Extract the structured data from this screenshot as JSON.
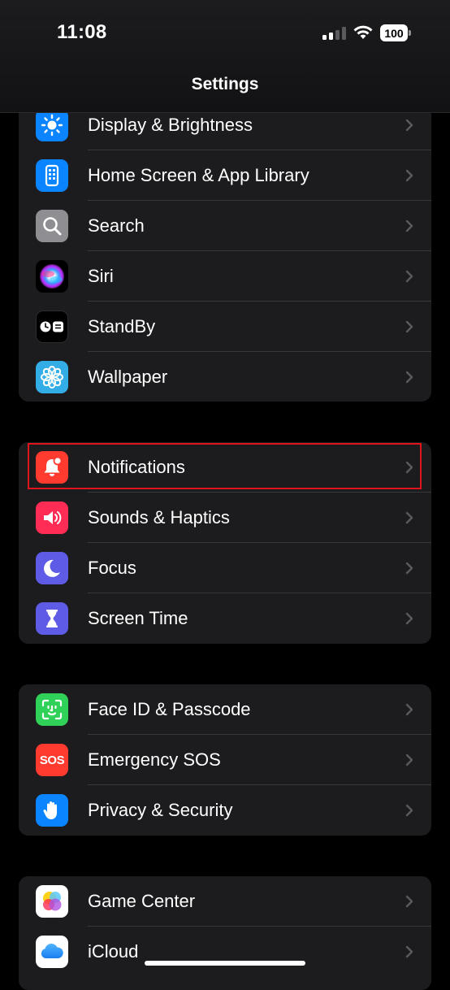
{
  "status_bar": {
    "time": "11:08",
    "battery_text": "100",
    "battery_color": "#ffffff"
  },
  "header": {
    "title": "Settings"
  },
  "groups": [
    {
      "items": [
        {
          "label": "Display & Brightness",
          "icon": "sun-icon",
          "color": "#0a84ff"
        },
        {
          "label": "Home Screen & App Library",
          "icon": "home-screen-icon",
          "color": "#0a84ff"
        },
        {
          "label": "Search",
          "icon": "magnifier-icon",
          "color": "#8e8e93"
        },
        {
          "label": "Siri",
          "icon": "siri-icon",
          "color": "#2c2c2e"
        },
        {
          "label": "StandBy",
          "icon": "standby-icon",
          "color": "#000000"
        },
        {
          "label": "Wallpaper",
          "icon": "flower-icon",
          "color": "#32ade6"
        }
      ]
    },
    {
      "items": [
        {
          "label": "Notifications",
          "icon": "bell-icon",
          "color": "#ff3b30"
        },
        {
          "label": "Sounds & Haptics",
          "icon": "speaker-icon",
          "color": "#ff2d55"
        },
        {
          "label": "Focus",
          "icon": "moon-icon",
          "color": "#5e5ce6"
        },
        {
          "label": "Screen Time",
          "icon": "hourglass-icon",
          "color": "#5e5ce6"
        }
      ]
    },
    {
      "items": [
        {
          "label": "Face ID & Passcode",
          "icon": "face-id-icon",
          "color": "#30d158"
        },
        {
          "label": "Emergency SOS",
          "icon": "sos-icon",
          "icon_text": "SOS",
          "color": "#ff3b30"
        },
        {
          "label": "Privacy & Security",
          "icon": "hand-icon",
          "color": "#0a84ff"
        }
      ]
    },
    {
      "items": [
        {
          "label": "Game Center",
          "icon": "game-center-icon",
          "color": "#ffffff"
        },
        {
          "label": "iCloud",
          "icon": "cloud-icon",
          "color": "#ffffff"
        }
      ]
    }
  ],
  "highlight_color": "#e0141b"
}
